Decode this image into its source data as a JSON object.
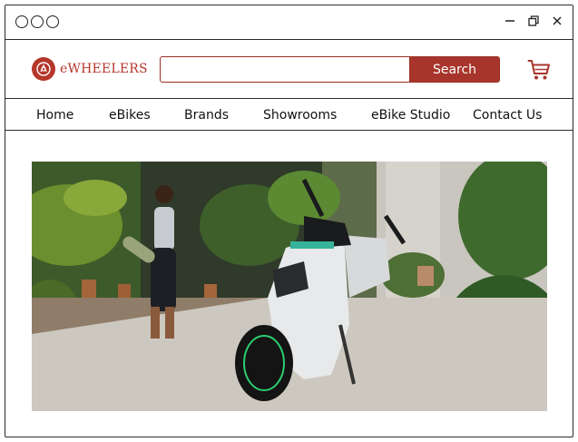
{
  "brand": {
    "logo_text": "eWHEELERS",
    "accent_color": "#a8352b"
  },
  "window": {
    "controls": [
      "minimize-icon",
      "restore-icon",
      "close-icon"
    ]
  },
  "search": {
    "placeholder": "",
    "value": "",
    "button_label": "Search"
  },
  "header": {
    "cart_icon": "cart-icon"
  },
  "nav": {
    "items": [
      {
        "label": "Home"
      },
      {
        "label": "eBikes"
      },
      {
        "label": "Brands"
      },
      {
        "label": "Showrooms"
      },
      {
        "label": "eBike Studio"
      },
      {
        "label": "Contact Us"
      }
    ]
  },
  "hero": {
    "image_alt": ""
  }
}
